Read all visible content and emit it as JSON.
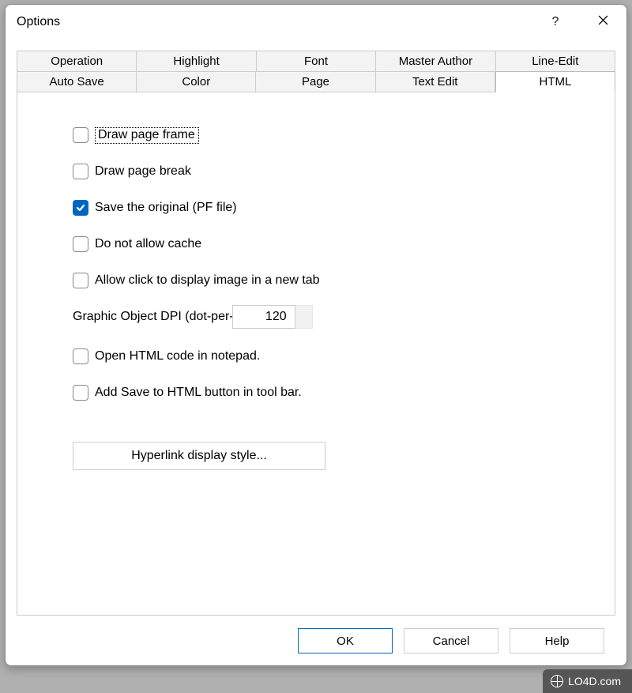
{
  "window": {
    "title": "Options",
    "help_tooltip": "?",
    "close_tooltip": "Close"
  },
  "tabs": {
    "row1": [
      "Operation",
      "Highlight",
      "Font",
      "Master Author",
      "Line-Edit"
    ],
    "row2": [
      "Auto Save",
      "Color",
      "Page",
      "Text Edit",
      "HTML"
    ],
    "active": "HTML"
  },
  "html_panel": {
    "draw_page_frame": {
      "label": "Draw page frame",
      "checked": false,
      "focused": true
    },
    "draw_page_break": {
      "label": "Draw page break",
      "checked": false
    },
    "save_original": {
      "label": "Save the original (PF file)",
      "checked": true
    },
    "no_cache": {
      "label": "Do not allow cache",
      "checked": false
    },
    "click_image_tab": {
      "label": "Allow click to display image in a new tab",
      "checked": false
    },
    "dpi": {
      "label": "Graphic Object DPI (dot-per-",
      "value": "120"
    },
    "open_notepad": {
      "label": "Open HTML code in notepad.",
      "checked": false
    },
    "add_save_btn": {
      "label": "Add Save to HTML button in tool bar.",
      "checked": false
    },
    "hyperlink_btn": "Hyperlink display style..."
  },
  "buttons": {
    "ok": "OK",
    "cancel": "Cancel",
    "help": "Help"
  },
  "watermark": "LO4D.com"
}
